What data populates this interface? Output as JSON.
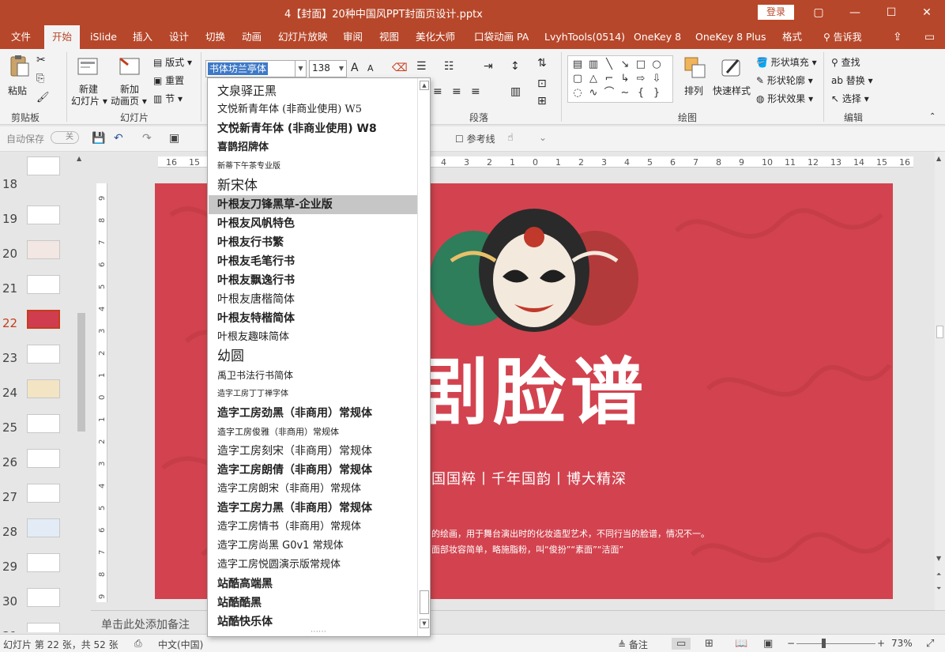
{
  "titlebar": {
    "title": "4【封面】20种中国风PPT封面页设计.pptx",
    "login_label": "登录",
    "minimize_glyph": "—",
    "restore_glyph": "▢",
    "maximize_glyph": "☐",
    "close_glyph": "✕"
  },
  "tabs": {
    "items": [
      "文件",
      "开始",
      "iSlide",
      "插入",
      "设计",
      "切换",
      "动画",
      "幻灯片放映",
      "审阅",
      "视图",
      "美化大师",
      "口袋动画 PA",
      "LvyhTools(0514)",
      "OneKey 8",
      "OneKey 8 Plus",
      "格式"
    ],
    "active": "开始",
    "tellme": "告诉我",
    "share_glyph": "⇪",
    "comment_glyph": "▭"
  },
  "ribbon": {
    "clipboard": {
      "paste": "粘贴",
      "label": "剪贴板"
    },
    "slides": {
      "new_slide": "新建\n幻灯片",
      "new_slide_1": "新建",
      "new_slide_2": "幻灯片 ▾",
      "new_anim_1": "新加",
      "new_anim_2": "动画页 ▾",
      "layout": "版式 ▾",
      "reset": "重置",
      "section": "节 ▾",
      "label": "幻灯片"
    },
    "font": {
      "name": "书体坊兰亭体",
      "size": "138",
      "grow_glyph": "A",
      "shrink_glyph": "A"
    },
    "paragraph": {
      "label": "段落"
    },
    "drawing": {
      "arrange": "排列",
      "quick_style": "快速样式",
      "fill": "形状填充 ▾",
      "outline": "形状轮廓 ▾",
      "effects": "形状效果 ▾",
      "label": "绘图"
    },
    "editing": {
      "find": "查找",
      "replace": "替换 ▾",
      "select": "选择 ▾",
      "label": "编辑"
    }
  },
  "qat": {
    "autosave": "自动保存",
    "autosave_state": "关",
    "guides": "参考线"
  },
  "thumbnails": {
    "items": [
      {
        "num": "18"
      },
      {
        "num": "19"
      },
      {
        "num": "20"
      },
      {
        "num": "21"
      },
      {
        "num": "22"
      },
      {
        "num": "23"
      },
      {
        "num": "24"
      },
      {
        "num": "25"
      },
      {
        "num": "26"
      },
      {
        "num": "27"
      },
      {
        "num": "28"
      },
      {
        "num": "29"
      },
      {
        "num": "30"
      },
      {
        "num": "31"
      }
    ],
    "active": "22"
  },
  "ruler": {
    "h_ticks": [
      "16",
      "15",
      "14",
      "13",
      "12",
      "11",
      "10",
      "9",
      "8",
      "7",
      "6",
      "5",
      "4",
      "3",
      "2",
      "1",
      "0",
      "1",
      "2",
      "3",
      "4",
      "5",
      "6",
      "7",
      "8",
      "9",
      "10",
      "11",
      "12",
      "13",
      "14",
      "15",
      "16"
    ],
    "v_ticks": [
      "9",
      "8",
      "7",
      "6",
      "5",
      "4",
      "3",
      "2",
      "1",
      "0",
      "1",
      "2",
      "3",
      "4",
      "5",
      "6",
      "7",
      "8",
      "9"
    ]
  },
  "slide": {
    "title": "剧脸谱",
    "subtitle": "国国粹丨千年国韵丨博大精深",
    "desc_line1": "的绘画，用于舞台演出时的化妆造型艺术，不同行当的脸谱，情况不一。",
    "desc_line2": "面部妆容简单，略施脂粉，叫“俊扮”“素面”“洁面”",
    "bg_color": "#d2434f"
  },
  "notes": {
    "placeholder": "单击此处添加备注"
  },
  "status": {
    "slide_info": "幻灯片 第 22 张，共 52 张",
    "language": "中文(中国)",
    "notes": "备注",
    "zoom": "73%"
  },
  "fontlist": {
    "items": [
      "文泉驿正黑",
      "文悦新青年体 (非商业使用) W5",
      "文悦新青年体 (非商业使用) W8",
      "喜鹊招牌体",
      "新蒂下午茶专业版",
      "新宋体",
      "叶根友刀锋黑草-企业版",
      "叶根友风帆特色",
      "叶根友行书繁",
      "叶根友毛笔行书",
      "叶根友飘逸行书",
      "叶根友唐楷简体",
      "叶根友特楷简体",
      "叶根友趣味简体",
      "幼圆",
      "禹卫书法行书简体",
      "造字工房丁丁禅字体",
      "造字工房劲黑（非商用）常规体",
      "造字工房俊雅（非商用）常规体",
      "造字工房刻宋（非商用）常规体",
      "造字工房朗倩（非商用）常规体",
      "造字工房朗宋（非商用）常规体",
      "造字工房力黑（非商用）常规体",
      "造字工房情书（非商用）常规体",
      "造字工房尚黑 G0v1 常规体",
      "造字工房悦圆演示版常规体",
      "站酷高端黑",
      "站酷酷黑",
      "站酷快乐体"
    ],
    "highlighted_index": 6
  }
}
